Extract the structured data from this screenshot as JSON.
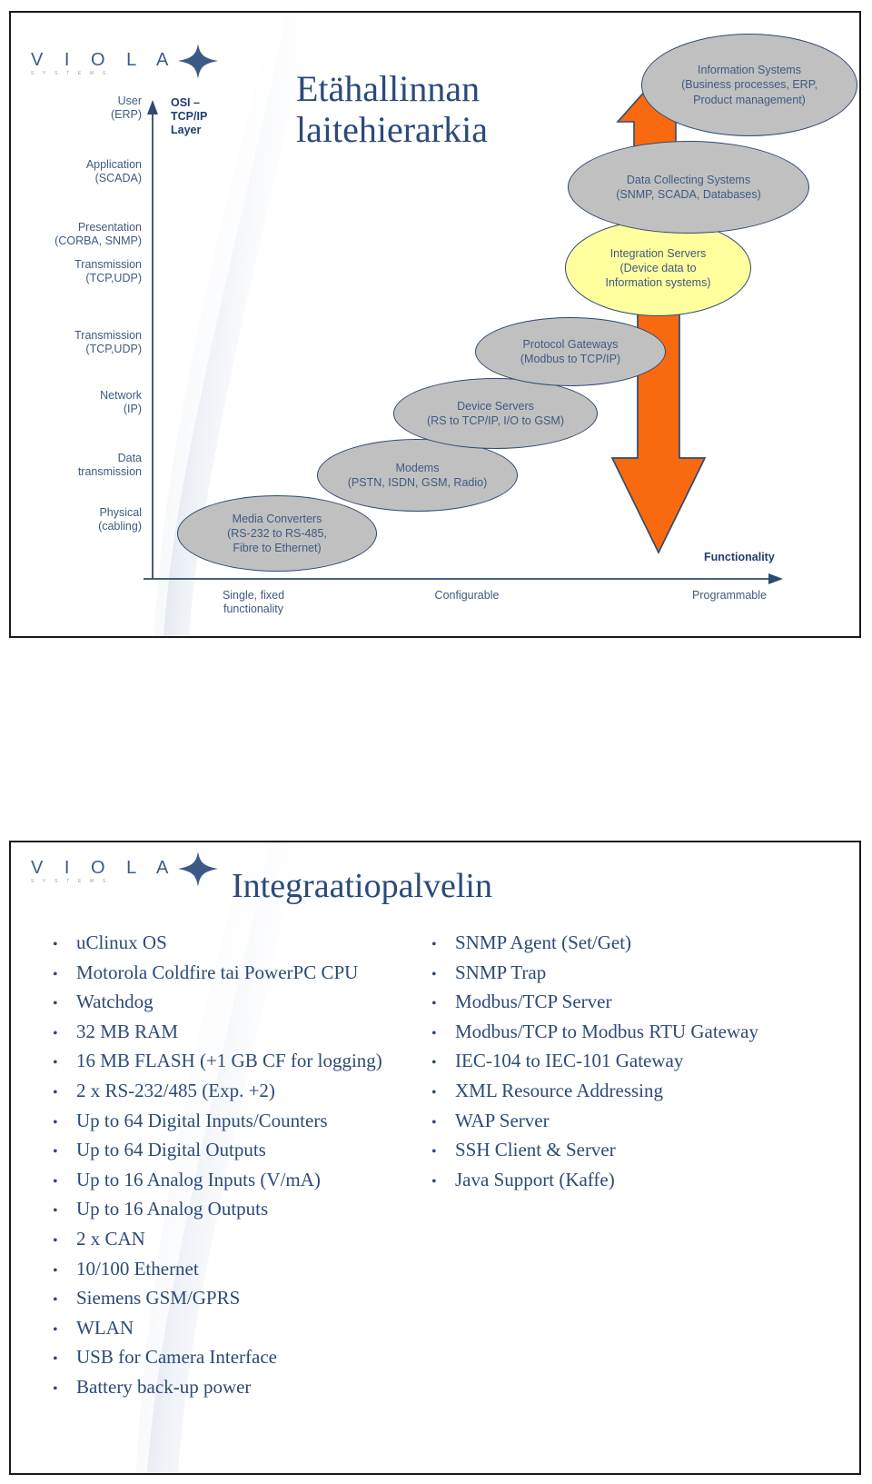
{
  "brand": {
    "logo_letters": "V I O L A",
    "logo_subtitle": "S Y S T E M S"
  },
  "slide1": {
    "title": "Etähallinnan\nlaitehierarkia",
    "title_line1": "Etähallinnan",
    "title_line2": "laitehierarkia",
    "y_axis_header": "OSI –\nTCP/IP\nLayer",
    "y_axis_header_lines": [
      "OSI –",
      "TCP/IP",
      "Layer"
    ],
    "osi_layers": [
      {
        "name": "User",
        "detail": "(ERP)"
      },
      {
        "name": "Application",
        "detail": "(SCADA)"
      },
      {
        "name": "Presentation",
        "detail": "(CORBA, SNMP)"
      },
      {
        "name": "Transmission",
        "detail": "(TCP,UDP)"
      },
      {
        "name": "Transmission",
        "detail": "(TCP,UDP)"
      },
      {
        "name": "Network",
        "detail": "(IP)"
      },
      {
        "name": "Data",
        "detail": "transmission"
      },
      {
        "name": "Physical",
        "detail": "(cabling)"
      }
    ],
    "x_axis_title": "Functionality",
    "x_axis_ticks": [
      {
        "line1": "Single, fixed",
        "line2": "functionality"
      },
      {
        "line1": "Configurable",
        "line2": ""
      },
      {
        "line1": "Programmable",
        "line2": ""
      }
    ],
    "nodes": [
      {
        "id": "information-systems",
        "line1": "Information Systems",
        "line2": "(Business processes, ERP,",
        "line3": "Product management)",
        "fill": "gray"
      },
      {
        "id": "data-collecting-systems",
        "line1": "Data Collecting Systems",
        "line2": "(SNMP, SCADA, Databases)",
        "line3": "",
        "fill": "gray"
      },
      {
        "id": "integration-servers",
        "line1": "Integration Servers",
        "line2": "(Device data to",
        "line3": "Information systems)",
        "fill": "yellow"
      },
      {
        "id": "protocol-gateways",
        "line1": "Protocol Gateways",
        "line2": "(Modbus to TCP/IP)",
        "line3": "",
        "fill": "gray"
      },
      {
        "id": "device-servers",
        "line1": "Device Servers",
        "line2": "(RS to TCP/IP, I/O to GSM)",
        "line3": "",
        "fill": "gray"
      },
      {
        "id": "modems",
        "line1": "Modems",
        "line2": "(PSTN, ISDN, GSM, Radio)",
        "line3": "",
        "fill": "gray"
      },
      {
        "id": "media-converters",
        "line1": "Media Converters",
        "line2": "(RS-232 to RS-485,",
        "line3": "Fibre to Ethernet)",
        "fill": "gray"
      }
    ],
    "colors": {
      "navy": "#2e4a72",
      "node_gray": "#c0c0c0",
      "node_yellow": "#ffff9e",
      "arrow_orange": "#f96a10",
      "text_blue": "#3f5a80"
    }
  },
  "slide2": {
    "title": "Integraatiopalvelin",
    "bullets_left": [
      "uClinux OS",
      "Motorola Coldfire tai PowerPC CPU",
      "Watchdog",
      "32 MB RAM",
      "16 MB FLASH (+1 GB CF for logging)",
      "2 x RS-232/485 (Exp. +2)",
      "Up to 64 Digital Inputs/Counters",
      "Up to 64 Digital Outputs",
      "Up to 16 Analog Inputs (V/mA)",
      "Up to 16 Analog Outputs",
      "2 x CAN",
      "10/100 Ethernet",
      "Siemens GSM/GPRS",
      "WLAN",
      "USB for Camera Interface",
      "Battery back-up power"
    ],
    "bullets_right": [
      "SNMP Agent (Set/Get)",
      "SNMP Trap",
      "Modbus/TCP Server",
      "Modbus/TCP to Modbus RTU Gateway",
      "IEC-104 to IEC-101 Gateway",
      "XML Resource Addressing",
      "WAP Server",
      "SSH Client & Server",
      "Java Support (Kaffe)"
    ],
    "bullet_marker": "•"
  }
}
